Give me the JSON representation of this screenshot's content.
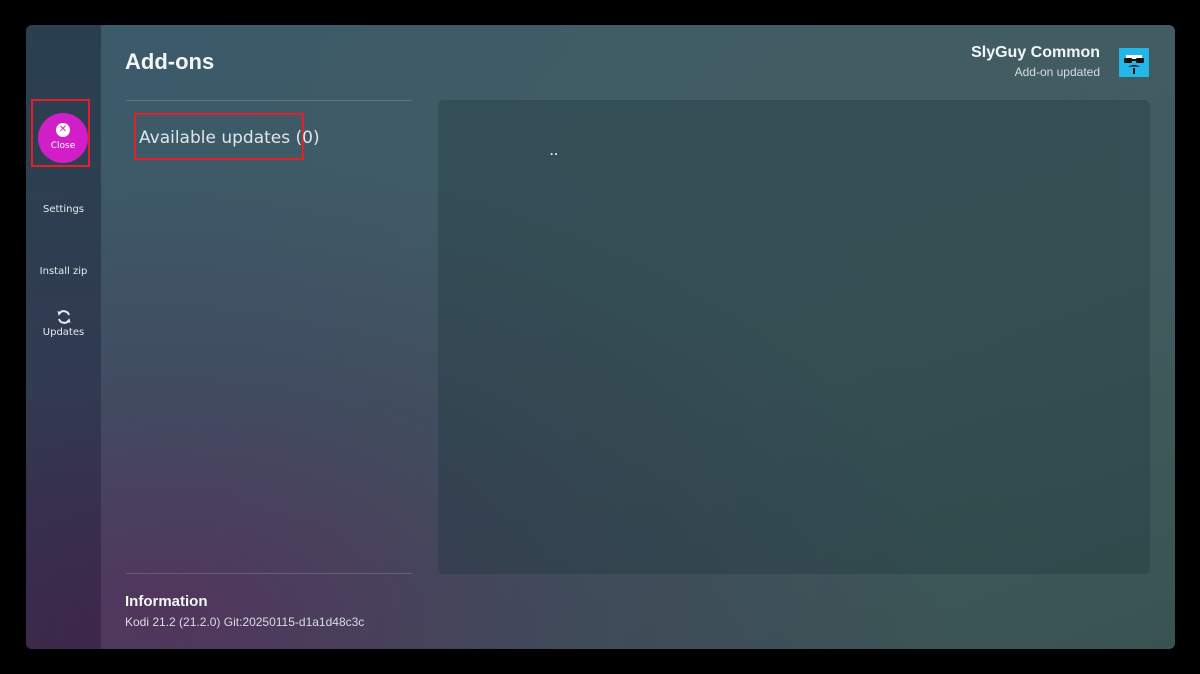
{
  "header": {
    "title": "Add-ons"
  },
  "notification": {
    "title": "SlyGuy Common",
    "subtitle": "Add-on updated",
    "icon": "glasses-mustache-icon",
    "icon_color": "#23b7e8"
  },
  "sidebar": {
    "close": {
      "label": "Close",
      "icon": "close-icon",
      "color": "#d21ec9"
    },
    "items": [
      {
        "label": "Settings"
      },
      {
        "label": "Install zip"
      },
      {
        "label": "Updates",
        "icon": "refresh-icon"
      }
    ]
  },
  "list": {
    "items": [
      {
        "label": "Available updates (0)"
      }
    ]
  },
  "panel": {
    "content": ".."
  },
  "info": {
    "title": "Information",
    "text": "Kodi 21.2 (21.2.0) Git:20250115-d1a1d48c3c"
  },
  "colors": {
    "highlight_border": "#e0202a"
  }
}
